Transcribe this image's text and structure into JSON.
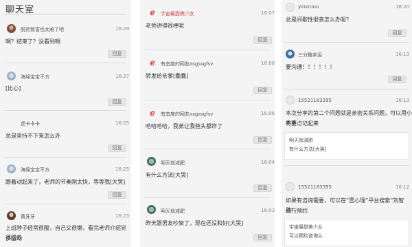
{
  "col1": {
    "title": "聊天室",
    "posts": [
      {
        "name": "脱贫致富也太难了吧",
        "time": "16:29",
        "msg": "啊？结束了？没看到啊",
        "reply": "回复"
      },
      {
        "name": "海绵宝宝不方",
        "time": "16:27",
        "msg": "[比心]",
        "reply": "回复"
      },
      {
        "name": "虎卡卡卡",
        "time": "16:25",
        "msg": "总是坚持不下来怎么办",
        "reply": "回复"
      },
      {
        "name": "海绵宝宝不方",
        "time": "16:25",
        "msg": "跟着动起来了，老师的节奏刚太快，等等我[大哭]",
        "reply": "回复"
      },
      {
        "name": "黄牙牙",
        "time": "16:23",
        "msg_lines": [
          "上班脖子经常很酸，自己又很懒，看完老师介绍觉得回去",
          "多运动"
        ],
        "reply": "回复"
      }
    ]
  },
  "col2": {
    "posts": [
      {
        "name": "宇宙最甜美少女",
        "time": "16:07",
        "msg": "老师讲得很棒呢",
        "reply": "回复"
      },
      {
        "name": "有态度的网友asgssgfsv",
        "time": "16:06",
        "msg": "转发给亲爹[蠢蠢]",
        "reply": "回复"
      },
      {
        "name": "有态度的网友asgssgfsv",
        "time": "16:06",
        "msg": "哈哈哈哈，我弟让我爸头都炸了",
        "reply": "回复"
      },
      {
        "name": "明天就减肥",
        "time": "16:04",
        "msg": "有什么方法[大哭]",
        "reply": "回复"
      },
      {
        "name": "明天就减肥",
        "time": "16:03",
        "msg": "昨天跟男友吵架了，现在还没和好[大哭]",
        "reply": "回复"
      }
    ]
  },
  "col3": {
    "posts": [
      {
        "name": "yinsruuu",
        "time": "16:20",
        "msg": "总是间歇性很丧怎么办呢？",
        "reply": "回复"
      },
      {
        "name": "三分糖幸运",
        "time": "16:13",
        "msg": "要沟通！！！！！！",
        "reply": "回复"
      },
      {
        "name": "15521183395",
        "time": "16:13",
        "msg_lines": [
          "本次分享的第二个问题就是亲密关系问题，可以用小本本",
          "将要点记起来"
        ],
        "quote": {
          "name": "明天就减肥",
          "msg": "有什么方法[大哭]"
        }
      },
      {
        "name": "15521183395",
        "time": "16:12",
        "msg_lines": [
          "如果有咨询需要，可以在“壹心理”平台搜索“刘智勋”",
          "进行预约"
        ],
        "quote": {
          "name": "宇宙最甜美少女",
          "msg": "可以预约咨询么"
        }
      }
    ]
  },
  "colors": {
    "background": "#f4f4f4",
    "reply_bg": "#e4e4e4",
    "brand_red": "#d23a3a"
  }
}
